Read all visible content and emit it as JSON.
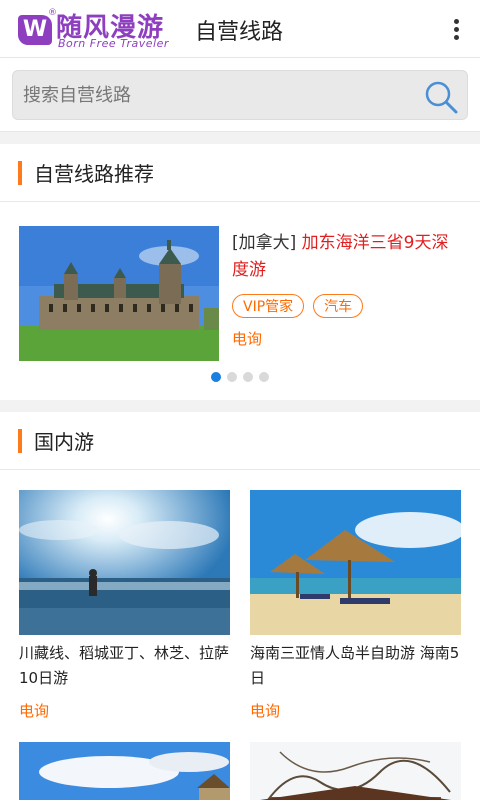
{
  "app_bar": {
    "logo_mark": "W",
    "logo_reg": "®",
    "logo_name": "随风漫游",
    "logo_sub": "Born Free Traveler",
    "title": "自营线路",
    "more_icon": "more-vertical-icon"
  },
  "search": {
    "placeholder": "搜索自营线路",
    "icon": "search-icon"
  },
  "recommend": {
    "heading": "自营线路推荐",
    "item": {
      "region": "[加拿大]",
      "name": "加东海洋三省9天深度游",
      "tags": [
        "VIP管家",
        "汽车"
      ],
      "call": "电询"
    },
    "pager": {
      "count": 4,
      "active": 0
    }
  },
  "domestic": {
    "heading": "国内游",
    "items": [
      {
        "title": "川藏线、稻城亚丁、林芝、拉萨10日游",
        "call": "电询"
      },
      {
        "title": "海南三亚情人岛半自助游 海南5日",
        "call": "电询"
      }
    ]
  },
  "colors": {
    "accent": "#ff7a1a",
    "brand": "#8e3fbf",
    "price_red": "#e02020",
    "pager_active": "#1a7fe0"
  }
}
